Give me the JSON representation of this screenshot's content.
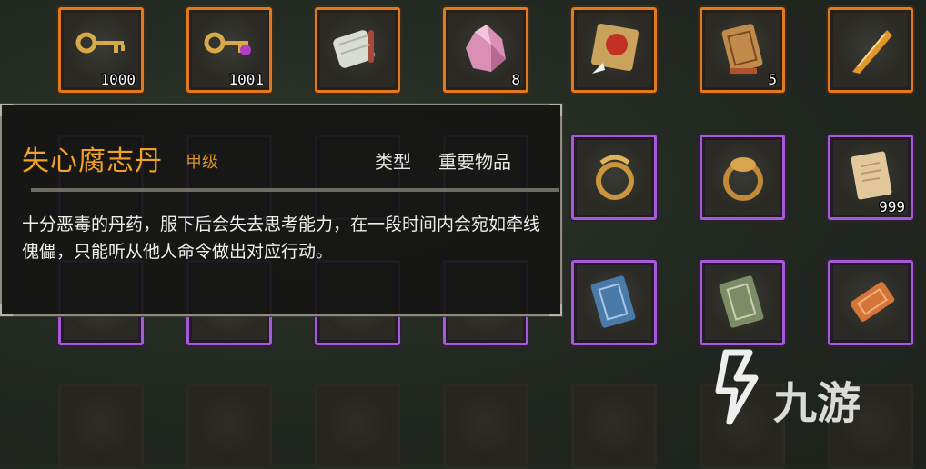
{
  "inventory": {
    "row1": [
      {
        "icon": "gold-key-icon",
        "count": "1000"
      },
      {
        "icon": "gem-key-icon",
        "count": "1001"
      },
      {
        "icon": "scroll-bundle-icon",
        "count": ""
      },
      {
        "icon": "pink-crystal-icon",
        "count": "8"
      },
      {
        "icon": "compass-map-icon",
        "count": ""
      },
      {
        "icon": "talisman-icon",
        "count": "5"
      },
      {
        "icon": "feather-brush-icon",
        "count": ""
      }
    ],
    "row2": [
      {
        "icon": "gold-ring-icon",
        "count": ""
      },
      {
        "icon": "ornate-ring-icon",
        "count": ""
      },
      {
        "icon": "parchment-icon",
        "count": "999"
      }
    ],
    "row3": [
      {
        "icon": "blue-book-icon",
        "count": ""
      },
      {
        "icon": "green-book-icon",
        "count": ""
      },
      {
        "icon": "orange-token-icon",
        "count": ""
      }
    ]
  },
  "tooltip": {
    "title": "失心腐志丹",
    "grade": "甲级",
    "type_label": "类型",
    "type_value": "重要物品",
    "description": "十分恶毒的丹药，服下后会失去思考能力，在一段时间内会宛如牵线傀儡，只能听从他人命令做出对应行动。"
  },
  "watermark": {
    "text": "九游"
  },
  "colors": {
    "legendary_border": "#e07a1e",
    "rare_border": "#a65ad6",
    "title": "#f0a326"
  }
}
